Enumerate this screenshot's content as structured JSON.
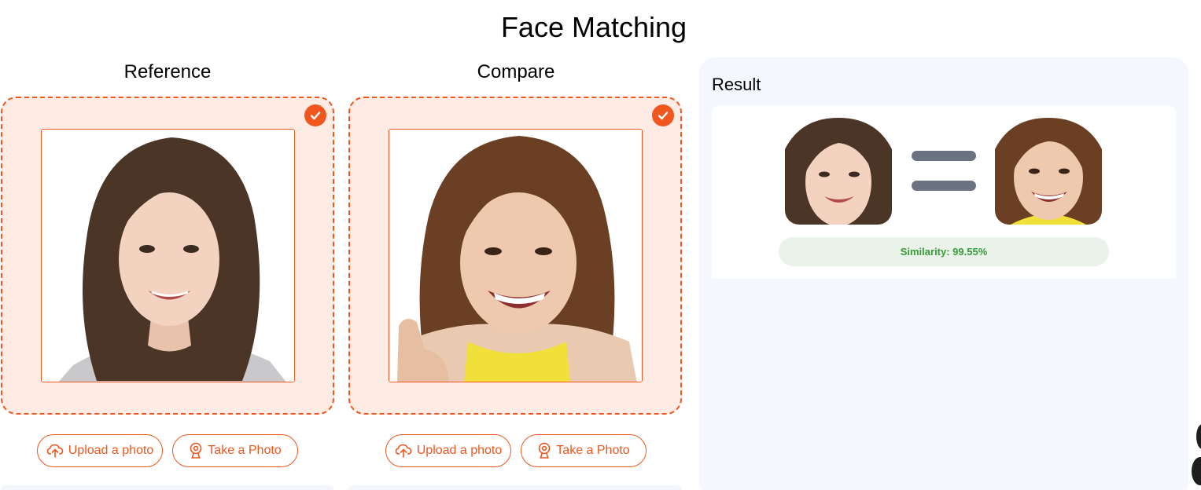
{
  "page": {
    "title": "Face Matching"
  },
  "reference": {
    "heading": "Reference",
    "upload_label": "Upload a photo",
    "camera_label": "Take a Photo",
    "selected": true
  },
  "compare": {
    "heading": "Compare",
    "upload_label": "Upload a photo",
    "camera_label": "Take a Photo",
    "selected": true
  },
  "result": {
    "title": "Result",
    "relation_icon": "equals-icon",
    "similarity_text": "Similarity: 99.55%"
  },
  "colors": {
    "accent": "#f0561e",
    "dropzone_bg": "#fdebe4",
    "result_bg": "#f4f7fd",
    "equals": "#6b7280",
    "similarity_bg": "#e9f3e9",
    "similarity_text": "#3a9a3a"
  },
  "icons": {
    "check": "check-circle-icon",
    "upload": "cloud-upload-icon",
    "camera": "webcam-icon"
  }
}
